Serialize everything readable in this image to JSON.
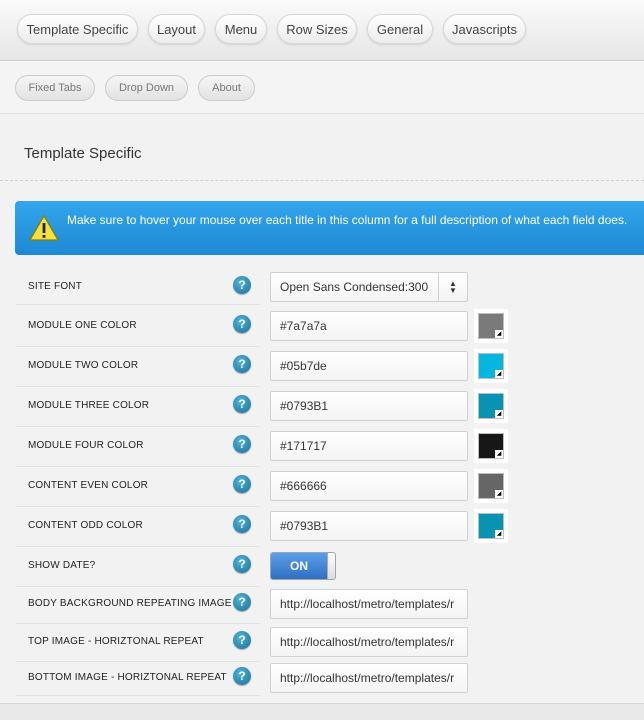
{
  "main_tabs": [
    "Template Specific",
    "Layout",
    "Menu",
    "Row Sizes",
    "General",
    "Javascripts"
  ],
  "sub_tabs": [
    "Fixed Tabs",
    "Drop Down",
    "About"
  ],
  "section_title": "Template Specific",
  "info_message": "Make sure to hover your mouse over each title in this column for a full description of what each field does.",
  "help_glyph": "?",
  "rows": [
    {
      "label": "SITE FONT",
      "type": "select",
      "value": "Open Sans Condensed:300"
    },
    {
      "label": "MODULE ONE COLOR",
      "type": "color",
      "value": "#7a7a7a",
      "swatch": "#7a7a7a"
    },
    {
      "label": "MODULE TWO COLOR",
      "type": "color",
      "value": "#05b7de",
      "swatch": "#05b7de"
    },
    {
      "label": "MODULE THREE COLOR",
      "type": "color",
      "value": "#0793B1",
      "swatch": "#0793B1"
    },
    {
      "label": "MODULE FOUR COLOR",
      "type": "color",
      "value": "#171717",
      "swatch": "#171717"
    },
    {
      "label": "CONTENT EVEN COLOR",
      "type": "color",
      "value": "#666666",
      "swatch": "#666666"
    },
    {
      "label": "CONTENT ODD COLOR",
      "type": "color",
      "value": "#0793B1",
      "swatch": "#0793B1"
    },
    {
      "label": "SHOW DATE?",
      "type": "toggle",
      "value": "ON"
    },
    {
      "label": "BODY BACKGROUND REPEATING IMAGE",
      "type": "text",
      "value": "http://localhost/metro/templates/r"
    },
    {
      "label": "TOP IMAGE - HORIZTONAL REPEAT",
      "type": "text",
      "value": "http://localhost/metro/templates/r"
    },
    {
      "label": "BOTTOM IMAGE - HORIZTONAL REPEAT",
      "type": "text",
      "value": "http://localhost/metro/templates/r"
    }
  ],
  "colors": {
    "info_bar": "#1e88d4",
    "toggle_on": "#2f6fc4",
    "help_icon": "#1a6f98"
  }
}
